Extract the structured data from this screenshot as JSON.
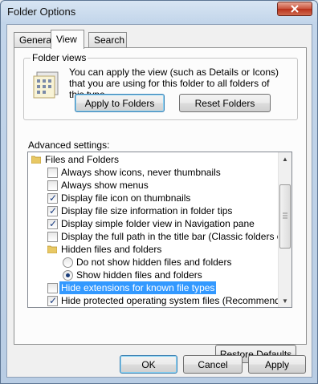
{
  "window": {
    "title": "Folder Options"
  },
  "tabs": [
    {
      "label": "General"
    },
    {
      "label": "View"
    },
    {
      "label": "Search"
    }
  ],
  "folder_views": {
    "group_label": "Folder views",
    "description": "You can apply the view (such as Details or Icons) that you are using for this folder to all folders of this type.",
    "apply_button": "Apply to Folders",
    "reset_button": "Reset Folders"
  },
  "advanced": {
    "label": "Advanced settings:",
    "items": [
      {
        "type": "folder",
        "label": "Files and Folders"
      },
      {
        "type": "checkbox",
        "label": "Always show icons, never thumbnails",
        "checked": false
      },
      {
        "type": "checkbox",
        "label": "Always show menus",
        "checked": false
      },
      {
        "type": "checkbox",
        "label": "Display file icon on thumbnails",
        "checked": true
      },
      {
        "type": "checkbox",
        "label": "Display file size information in folder tips",
        "checked": true
      },
      {
        "type": "checkbox",
        "label": "Display simple folder view in Navigation pane",
        "checked": true
      },
      {
        "type": "checkbox",
        "label": "Display the full path in the title bar (Classic folders only)",
        "checked": false
      },
      {
        "type": "folder",
        "label": "Hidden files and folders"
      },
      {
        "type": "radio",
        "label": "Do not show hidden files and folders",
        "checked": false
      },
      {
        "type": "radio",
        "label": "Show hidden files and folders",
        "checked": true
      },
      {
        "type": "checkbox",
        "label": "Hide extensions for known file types",
        "checked": false,
        "selected": true
      },
      {
        "type": "checkbox",
        "label": "Hide protected operating system files (Recommended)",
        "checked": true
      }
    ]
  },
  "restore_button": "Restore Defaults",
  "footer": {
    "ok": "OK",
    "cancel": "Cancel",
    "apply": "Apply"
  },
  "icons": {
    "close": "close-icon",
    "folder": "folder-icon",
    "scroll_up": "scroll-up-icon",
    "scroll_down": "scroll-down-icon",
    "folder_views": "folder-views-icon"
  },
  "colors": {
    "selection": "#3399ff",
    "window_frame": "#b9cde4"
  }
}
